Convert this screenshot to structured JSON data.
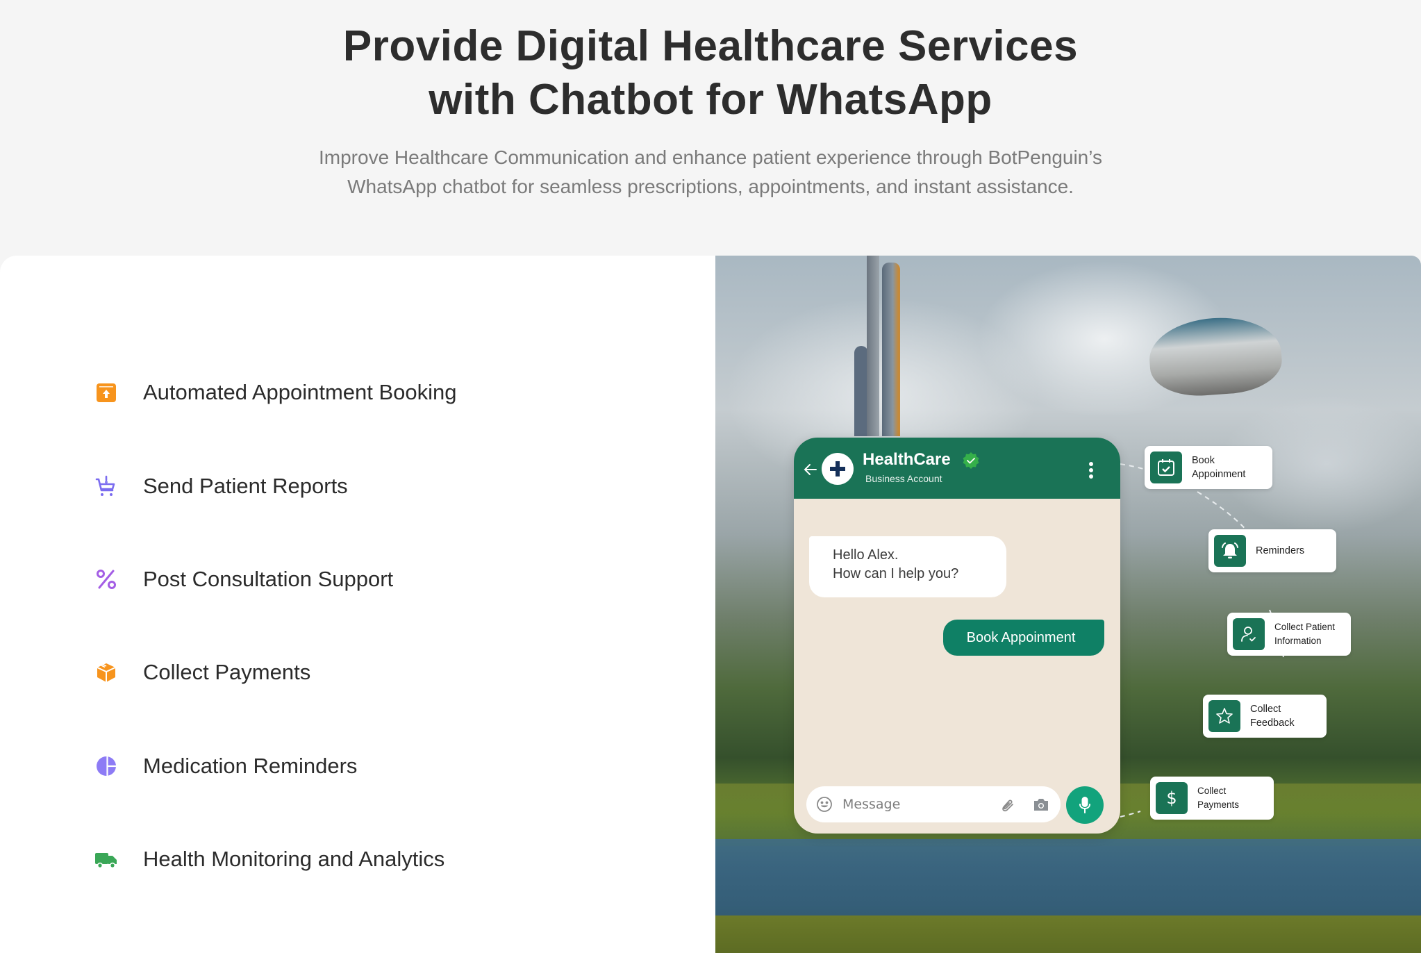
{
  "hero": {
    "title_line1": "Provide Digital Healthcare Services",
    "title_line2": "with Chatbot for WhatsApp",
    "subtitle_line1": "Improve Healthcare Communication and enhance patient experience through BotPenguin’s",
    "subtitle_line2": "WhatsApp chatbot for seamless prescriptions, appointments, and instant assistance."
  },
  "features": [
    {
      "label": "Automated Appointment Booking",
      "icon": "calendar-upload-icon",
      "color": "#f7941d"
    },
    {
      "label": "Send Patient Reports",
      "icon": "cart-alert-icon",
      "color": "#7b6cf0"
    },
    {
      "label": "Post Consultation Support",
      "icon": "percent-icon",
      "color": "#a45ee5"
    },
    {
      "label": "Collect Payments",
      "icon": "box-icon",
      "color": "#f7941d"
    },
    {
      "label": "Medication Reminders",
      "icon": "pie-chart-icon",
      "color": "#8d7bf5"
    },
    {
      "label": "Health Monitoring and Analytics",
      "icon": "truck-icon",
      "color": "#3aa757"
    }
  ],
  "chat": {
    "title": "HealthCare",
    "subtitle": "Business Account",
    "incoming_line1": "Hello Alex.",
    "incoming_line2": "How can I help you?",
    "outgoing": "Book Appoinment",
    "input_placeholder": "Message",
    "header_color": "#1a7356",
    "accent": "#12a37c"
  },
  "flow_steps": [
    {
      "line1": "Book",
      "line2": "Appoinment",
      "icon": "calendar-check-icon"
    },
    {
      "line1": "Reminders",
      "line2": "",
      "icon": "bell-icon"
    },
    {
      "line1": "Collect Patient",
      "line2": "Information",
      "icon": "user-check-icon"
    },
    {
      "line1": "Collect",
      "line2": "Feedback",
      "icon": "star-icon"
    },
    {
      "line1": "Collect",
      "line2": "Payments",
      "icon": "dollar-icon"
    }
  ]
}
